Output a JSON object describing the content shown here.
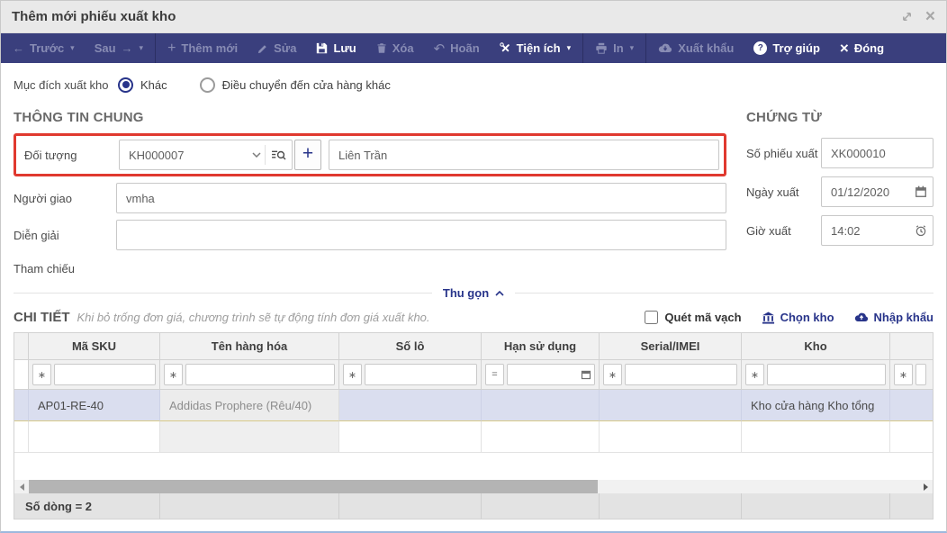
{
  "window": {
    "title": "Thêm mới phiếu xuất kho"
  },
  "colors": {
    "toolbar_bg": "#3a3f7d",
    "accent_navy": "#28348a",
    "highlight_red": "#e0392f",
    "selected_row_bg": "#dadeef"
  },
  "icons": {
    "arrow_left": "←",
    "arrow_right": "→",
    "caret_down": "▾",
    "plus": "+",
    "undo": "↶",
    "close": "×",
    "question": "?"
  },
  "toolbar": {
    "items": [
      {
        "label": "Trước",
        "enabled": false
      },
      {
        "label": "Sau",
        "enabled": false
      },
      {
        "label": "Thêm mới",
        "enabled": false
      },
      {
        "label": "Sửa",
        "enabled": false
      },
      {
        "label": "Lưu",
        "enabled": true
      },
      {
        "label": "Xóa",
        "enabled": false
      },
      {
        "label": "Hoãn",
        "enabled": false
      },
      {
        "label": "Tiện ích",
        "enabled": true
      },
      {
        "label": "In",
        "enabled": false
      },
      {
        "label": "Xuất khẩu",
        "enabled": false
      },
      {
        "label": "Trợ giúp",
        "enabled": true
      },
      {
        "label": "Đóng",
        "enabled": true
      }
    ]
  },
  "purpose": {
    "label": "Mục đích xuất kho",
    "options": [
      {
        "label": "Khác",
        "selected": true
      },
      {
        "label": "Điều chuyển đến cửa hàng khác",
        "selected": false
      }
    ]
  },
  "general": {
    "title": "THÔNG TIN CHUNG",
    "doi_tuong": {
      "label": "Đối tượng",
      "code": "KH000007",
      "name": "Liên Trần"
    },
    "nguoi_giao": {
      "label": "Người giao",
      "value": "vmha"
    },
    "dien_giai": {
      "label": "Diễn giải",
      "value": ""
    },
    "tham_chieu": {
      "label": "Tham chiếu"
    }
  },
  "document": {
    "title": "CHỨNG TỪ",
    "so_phieu": {
      "label": "Số phiếu xuất",
      "value": "XK000010"
    },
    "ngay_xuat": {
      "label": "Ngày xuất",
      "value": "01/12/2020"
    },
    "gio_xuat": {
      "label": "Giờ xuất",
      "value": "14:02"
    }
  },
  "collapse_label": "Thu gọn",
  "detail": {
    "title": "CHI TIẾT",
    "hint": "Khi bỏ trống đơn giá, chương trình sẽ tự động tính đơn giá xuất kho.",
    "barcode_label": "Quét mã vạch",
    "chon_kho_label": "Chọn kho",
    "nhap_khau_label": "Nhập khẩu"
  },
  "table": {
    "columns": [
      "Mã SKU",
      "Tên hàng hóa",
      "Số lô",
      "Hạn sử dụng",
      "Serial/IMEI",
      "Kho"
    ],
    "filter_operators": [
      "∗",
      "∗",
      "∗",
      "=",
      "∗",
      "∗",
      "∗"
    ],
    "rows": [
      {
        "sku": "AP01-RE-40",
        "name": "Addidas Prophere (Rêu/40)",
        "lot": "",
        "expiry": "",
        "serial": "",
        "kho": "Kho cửa hàng Kho tổng"
      },
      {
        "sku": "",
        "name": "",
        "lot": "",
        "expiry": "",
        "serial": "",
        "kho": ""
      }
    ],
    "footer_label": "Số dòng = 2"
  }
}
